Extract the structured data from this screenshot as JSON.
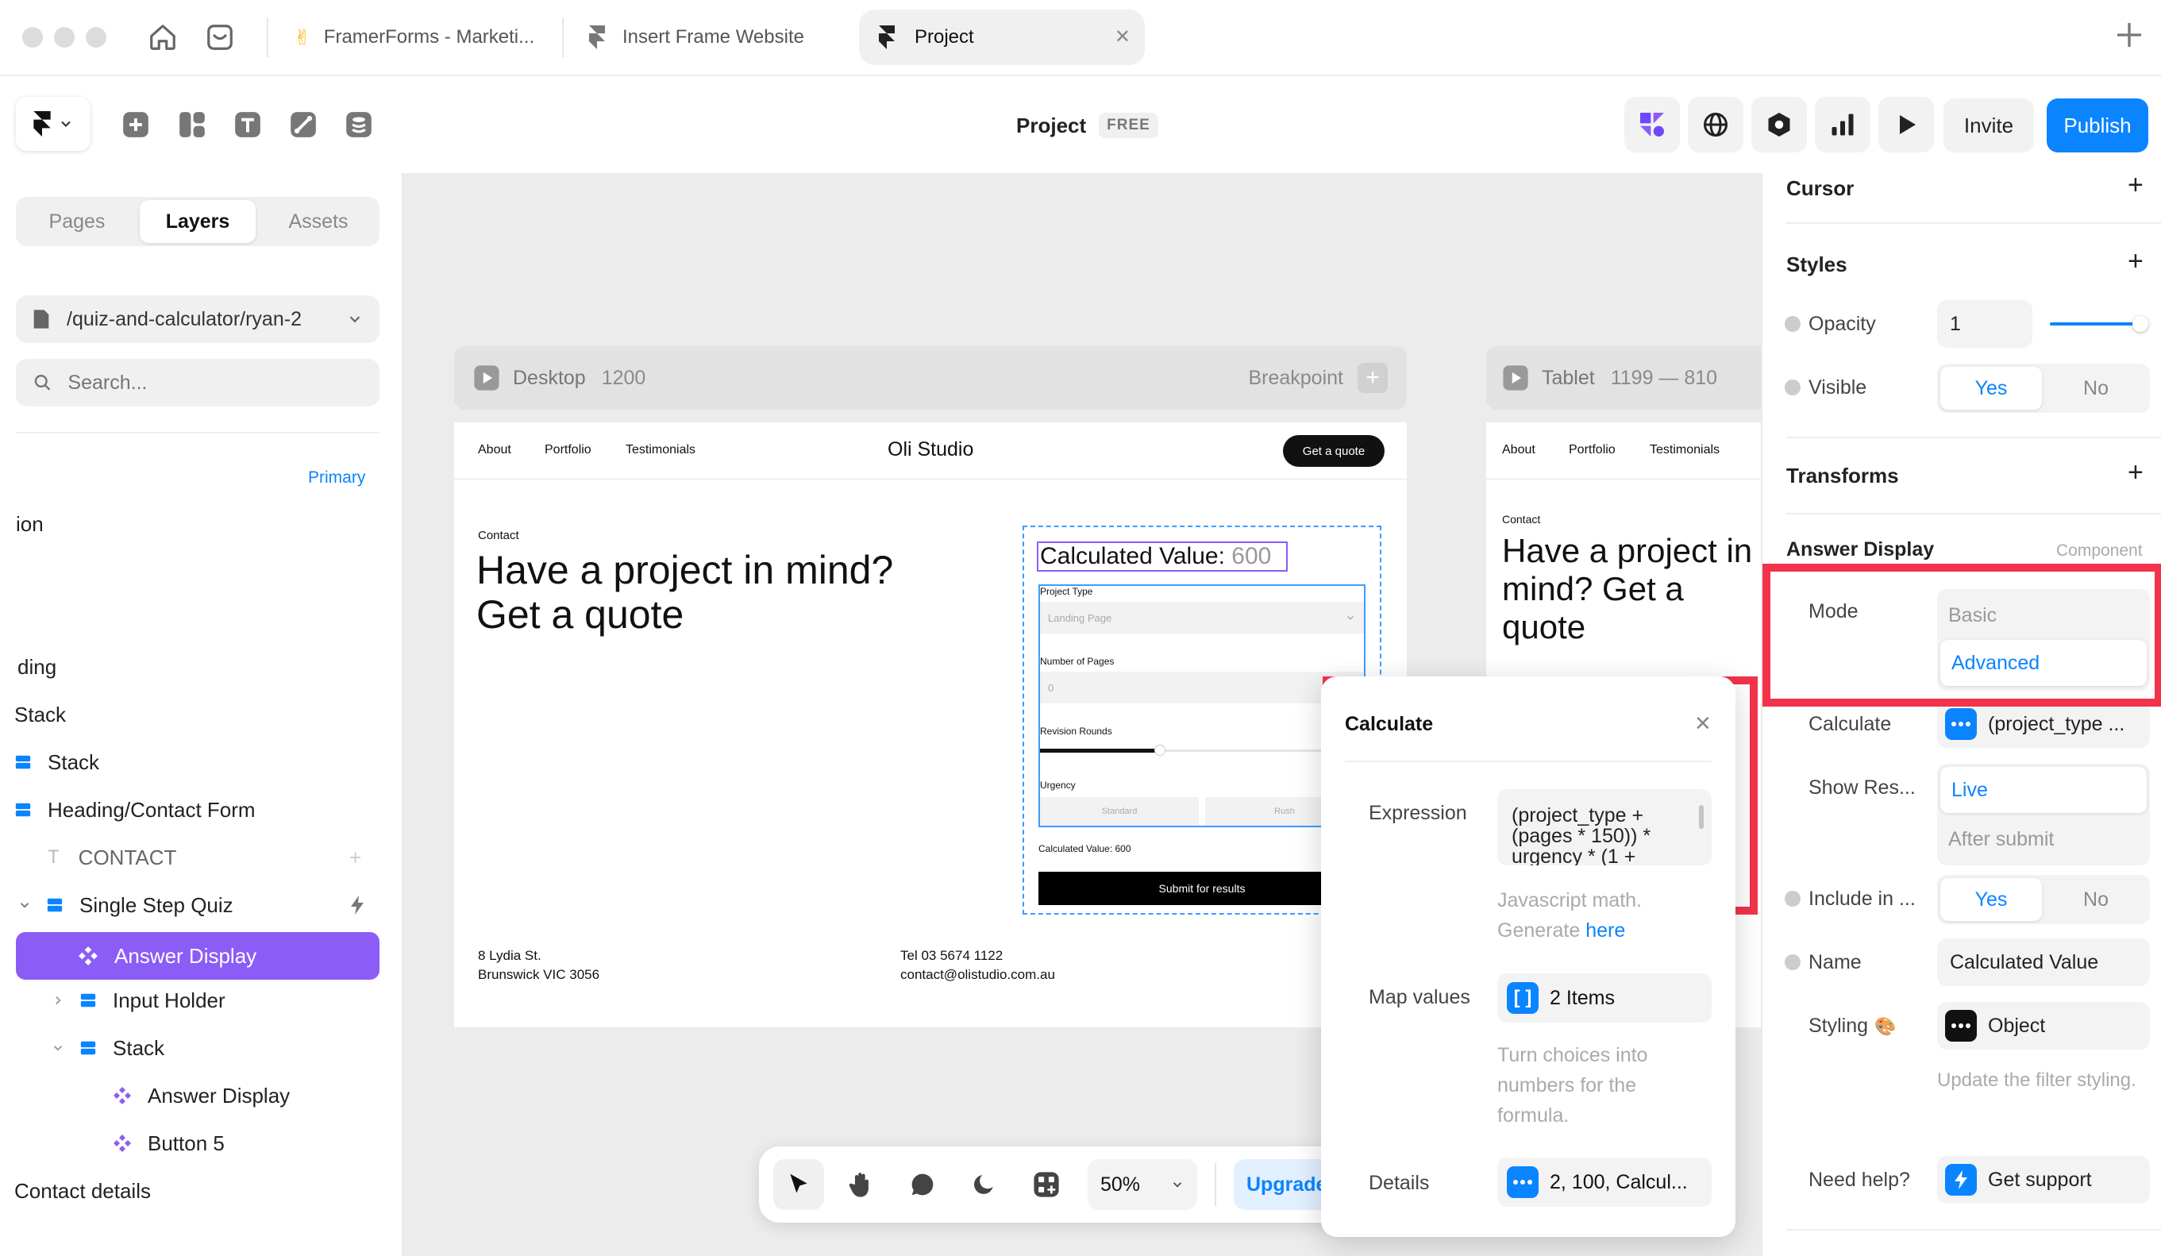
{
  "tabs": {
    "items": [
      {
        "label": "FramerForms - Marketi...",
        "icon": "hand-emoji"
      },
      {
        "label": "Insert Frame Website",
        "icon": "framer-logo-icon"
      },
      {
        "label": "Project",
        "icon": "framer-logo-icon",
        "active": true
      }
    ]
  },
  "toolbar": {
    "project_name": "Project",
    "plan_badge": "FREE",
    "invite_label": "Invite",
    "publish_label": "Publish"
  },
  "left": {
    "tabs": [
      "Pages",
      "Layers",
      "Assets"
    ],
    "active_tab": "Layers",
    "page_path": "/quiz-and-calculator/ryan-2",
    "search_placeholder": "Search...",
    "primary_label": "Primary",
    "layers": [
      {
        "label": "ion"
      },
      {
        "label": "ding"
      },
      {
        "label": "Stack"
      },
      {
        "label": "Stack"
      },
      {
        "label": "Heading/Contact Form"
      },
      {
        "label": "CONTACT"
      },
      {
        "label": "Single Step Quiz"
      },
      {
        "label": "Answer Display"
      },
      {
        "label": "Input Holder"
      },
      {
        "label": "Stack"
      },
      {
        "label": "Answer Display"
      },
      {
        "label": "Button 5"
      },
      {
        "label": "Contact details"
      }
    ]
  },
  "canvas": {
    "desktop": {
      "label": "Desktop",
      "width": "1200",
      "breakpoint_label": "Breakpoint"
    },
    "tablet": {
      "label": "Tablet",
      "range": "1199 — 810"
    },
    "site": {
      "nav": [
        "About",
        "Portfolio",
        "Testimonials"
      ],
      "brand": "Oli Studio",
      "cta": "Get a quote",
      "eyebrow": "Contact",
      "heading": "Have a project in mind? Get a quote",
      "calc_label": "Calculated Value:",
      "calc_value": "600",
      "field_project_type": "Project Type",
      "field_project_value": "Landing Page",
      "field_pages": "Number of Pages",
      "field_pages_value": "0",
      "field_revisions": "Revision Rounds",
      "field_urgency": "Urgency",
      "urgency_options": [
        "Standard",
        "Rush"
      ],
      "small_calc": "Calculated Value: 600",
      "submit": "Submit for results",
      "address1": "8 Lydia St.",
      "address2": "Brunswick VIC 3056",
      "phone": "Tel 03 5674 1122",
      "email": "contact@olistudio.com.au"
    },
    "tablet_site": {
      "nav": [
        "About",
        "Portfolio",
        "Testimonials"
      ],
      "eyebrow": "Contact",
      "heading": "Have a project in mind? Get a quote"
    },
    "bottom_toolbar": {
      "zoom": "50%",
      "upgrade": "Upgrade"
    }
  },
  "popover": {
    "title": "Calculate",
    "expression_label": "Expression",
    "expression_value": "(project_type + (pages * 150)) * urgency * (1 +",
    "hint_prefix": "Javascript math.",
    "hint_generate": "Generate",
    "hint_link": "here",
    "map_label": "Map values",
    "map_value": "2 Items",
    "map_hint": "Turn choices into numbers for the formula.",
    "details_label": "Details",
    "details_value": "2, 100, Calcul..."
  },
  "right": {
    "cursor": "Cursor",
    "styles": "Styles",
    "opacity_label": "Opacity",
    "opacity_value": "1",
    "opacity_level": 0.95,
    "visible_label": "Visible",
    "yes": "Yes",
    "no": "No",
    "transforms": "Transforms",
    "component_title": "Answer Display",
    "component_tag": "Component",
    "mode_label": "Mode",
    "mode_basic": "Basic",
    "mode_advanced": "Advanced",
    "calculate_label": "Calculate",
    "calculate_value": "(project_type ...",
    "show_results_label": "Show Res...",
    "show_live": "Live",
    "show_after": "After submit",
    "include_label": "Include in ...",
    "name_label": "Name",
    "name_value": "Calculated Value",
    "styling_label": "Styling",
    "styling_value": "Object",
    "styling_hint": "Update the filter styling.",
    "help_label": "Need help?",
    "help_value": "Get support"
  },
  "colors": {
    "accent": "#0a84ff",
    "purple": "#8b5cf6",
    "highlight": "#f2334b"
  }
}
